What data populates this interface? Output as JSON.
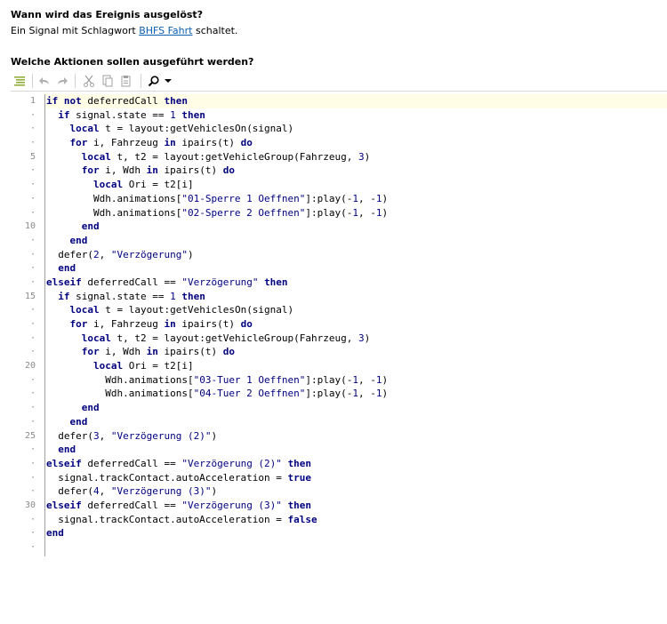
{
  "trigger_section": {
    "heading": "Wann wird das Ereignis ausgelöst?",
    "text_prefix": "Ein Signal mit Schlagwort ",
    "link": "BHFS Fahrt",
    "text_suffix": " schaltet."
  },
  "action_section": {
    "heading": "Welche Aktionen sollen ausgeführt werden?"
  },
  "toolbar": {
    "icons": [
      "format-icon",
      "undo-icon",
      "redo-icon",
      "cut-icon",
      "copy-icon",
      "paste-icon",
      "search-icon",
      "dropdown-arrow-icon"
    ]
  },
  "editor": {
    "gutter": [
      "1",
      "·",
      "·",
      "·",
      "5",
      "·",
      "·",
      "·",
      "·",
      "10",
      "·",
      "·",
      "·",
      "·",
      "15",
      "·",
      "·",
      "·",
      "·",
      "20",
      "·",
      "·",
      "·",
      "·",
      "25",
      "·",
      "·",
      "·",
      "·",
      "30",
      "·",
      "·",
      "·"
    ],
    "lines": [
      "if not deferredCall then",
      "  if signal.state == 1 then",
      "    local t = layout:getVehiclesOn(signal)",
      "    for i, Fahrzeug in ipairs(t) do",
      "      local t, t2 = layout:getVehicleGroup(Fahrzeug, 3)",
      "      for i, Wdh in ipairs(t) do",
      "        local Ori = t2[i]",
      "        Wdh.animations[\"01-Sperre 1 Oeffnen\"]:play(-1, -1)",
      "        Wdh.animations[\"02-Sperre 2 Oeffnen\"]:play(-1, -1)",
      "      end",
      "    end",
      "  defer(2, \"Verzögerung\")",
      "  end",
      "elseif deferredCall == \"Verzögerung\" then",
      "  if signal.state == 1 then",
      "    local t = layout:getVehiclesOn(signal)",
      "    for i, Fahrzeug in ipairs(t) do",
      "      local t, t2 = layout:getVehicleGroup(Fahrzeug, 3)",
      "      for i, Wdh in ipairs(t) do",
      "        local Ori = t2[i]",
      "          Wdh.animations[\"03-Tuer 1 Oeffnen\"]:play(-1, -1)",
      "          Wdh.animations[\"04-Tuer 2 Oeffnen\"]:play(-1, -1)",
      "      end",
      "    end",
      "  defer(3, \"Verzögerung (2)\")",
      "  end",
      "elseif deferredCall == \"Verzögerung (2)\" then",
      "  signal.trackContact.autoAcceleration = true",
      "  defer(4, \"Verzögerung (3)\")",
      "elseif deferredCall == \"Verzögerung (3)\" then",
      "  signal.trackContact.autoAcceleration = false",
      "end",
      ""
    ]
  }
}
